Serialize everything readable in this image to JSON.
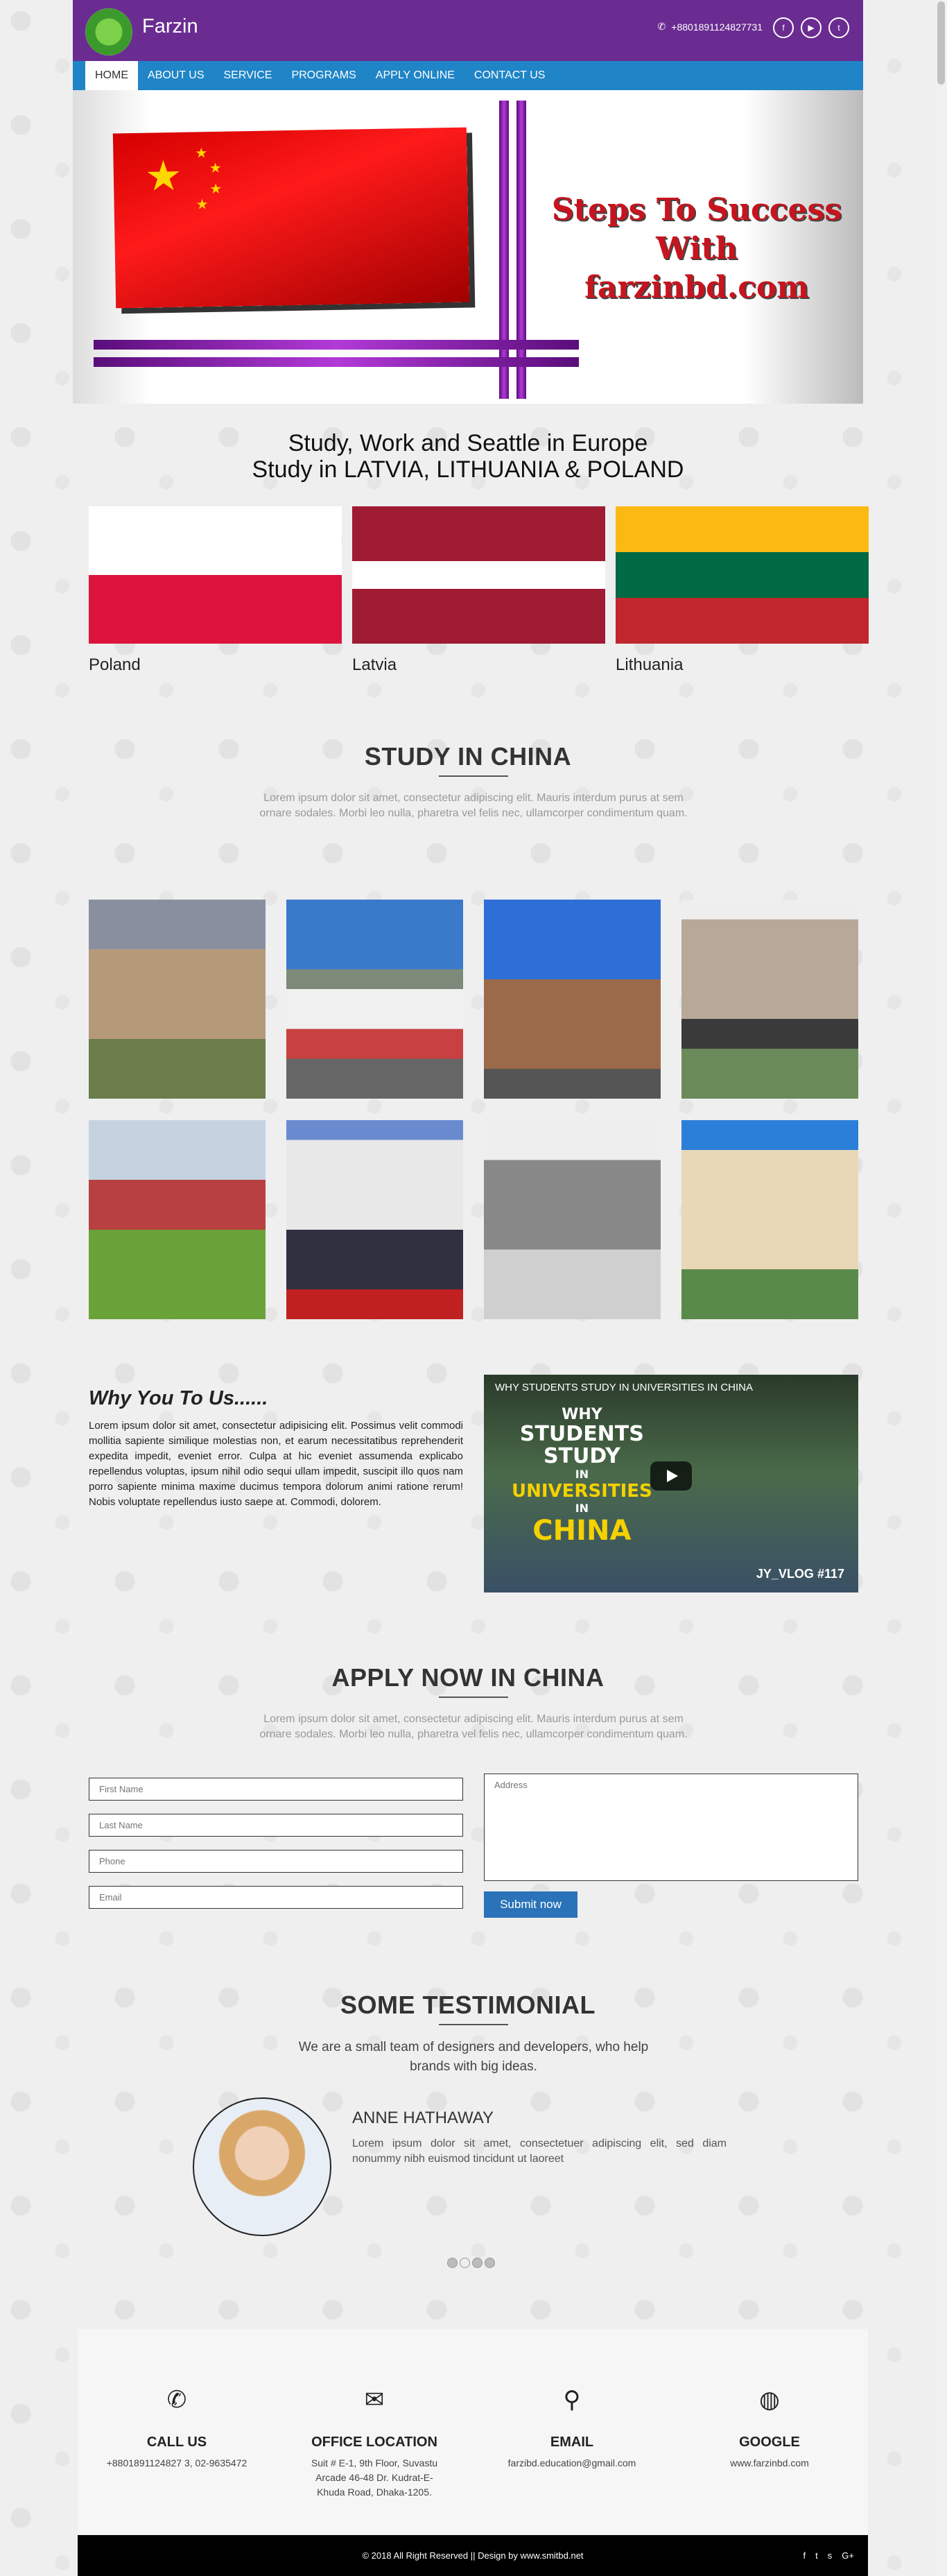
{
  "header": {
    "brand": "Farzin",
    "phone": "+8801891124827731",
    "phone_icon": "phone-icon",
    "socials": [
      "f",
      "▶",
      "t"
    ]
  },
  "nav": {
    "items": [
      "HOME",
      "ABOUT US",
      "SERVICE",
      "PROGRAMS",
      "APPLY ONLINE",
      "CONTACT US"
    ],
    "active": "HOME",
    "color": "#2085c7"
  },
  "hero": {
    "line1": "Steps To Success",
    "line2": "With farzinbd.com"
  },
  "europe": {
    "line1": "Study, Work and Seattle in Europe",
    "line2": "Study in LATVIA, LITHUANIA & POLAND",
    "flags": [
      {
        "name": "Poland"
      },
      {
        "name": "Latvia"
      },
      {
        "name": "Lithuania"
      }
    ]
  },
  "study": {
    "title": "STUDY IN CHINA",
    "subtitle": "Lorem ipsum dolor sit amet, consectetur adipiscing elit. Mauris interdum purus at sem ornare sodales. Morbi leo nulla, pharetra vel felis nec, ullamcorper condimentum quam."
  },
  "why": {
    "title": "Why You To Us......",
    "text": "Lorem ipsum dolor sit amet, consectetur adipisicing elit. Possimus velit commodi mollitia sapiente similique molestias non, et earum necessitatibus reprehenderit expedita impedit, eveniet error. Culpa at hic eveniet assumenda explicabo repellendus voluptas, ipsum nihil odio sequi ullam impedit, suscipit illo quos nam porro sapiente minima maxime ducimus tempora dolorum animi ratione rerum! Nobis voluptate repellendus iusto saepe at. Commodi, dolorem.",
    "video_title": "WHY STUDENTS STUDY IN UNIVERSITIES IN CHINA",
    "video_big1": "WHY",
    "video_big2": "STUDENTS",
    "video_big3": "STUDY",
    "video_big4": "IN",
    "video_big5": "UNIVERSITIES",
    "video_big6": "IN",
    "video_big7": "CHINA",
    "video_tag": "JY_VLOG #117"
  },
  "apply": {
    "title": "APPLY NOW IN CHINA",
    "subtitle": "Lorem ipsum dolor sit amet, consectetur adipiscing elit. Mauris interdum purus at sem ornare sodales. Morbi leo nulla, pharetra vel felis nec, ullamcorper condimentum quam.",
    "first": "First Name",
    "last": "Last Name",
    "phone": "Phone",
    "email": "Email",
    "address": "Address",
    "submit": "Submit now"
  },
  "testimonial": {
    "title": "SOME TESTIMONIAL",
    "subtitle": "We are a small team of designers and developers, who help brands with big ideas.",
    "name": "ANNE HATHAWAY",
    "text": "Lorem ipsum dolor sit amet, consectetuer adipiscing elit, sed diam nonummy nibh euismod tincidunt ut laoreet"
  },
  "footer": {
    "call_title": "CALL US",
    "call_text": "+8801891124827 3, 02-9635472",
    "office_title": "OFFICE LOCATION",
    "office_text": "Suit # E-1, 9th Floor, Suvastu Arcade 46-48 Dr. Kudrat-E-Khuda Road, Dhaka-1205.",
    "email_title": "EMAIL",
    "email_text": "farzibd.education@gmail.com",
    "google_title": "GOOGLE",
    "google_text": "www.farzinbd.com",
    "copyright": "© 2018 All Right Reserved || Design by www.smitbd.net",
    "bottom_socials": [
      "f",
      "t",
      "s",
      "G+"
    ]
  }
}
